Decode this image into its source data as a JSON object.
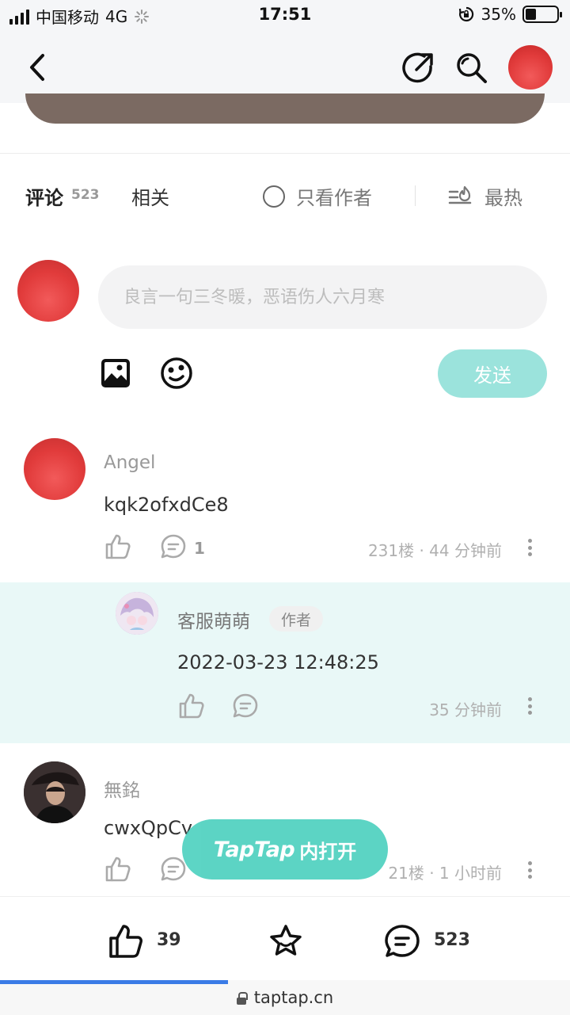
{
  "status_bar": {
    "carrier": "中国移动",
    "network": "4G",
    "time": "17:51",
    "battery": "35%",
    "battery_level": 0.35
  },
  "nav": {
    "icons": [
      "back-icon",
      "share-icon",
      "search-icon",
      "avatar"
    ]
  },
  "tabs": {
    "comments_label": "评论",
    "comments_count": "523",
    "related_label": "相关",
    "author_only_label": "只看作者",
    "sort_label": "最热"
  },
  "compose": {
    "placeholder": "良言一句三冬暖，恶语伤人六月寒",
    "send_label": "发送"
  },
  "comments": [
    {
      "username": "Angel",
      "content": "kqk2ofxdCe8",
      "reply_count": "1",
      "meta": "231楼 · 44 分钟前",
      "reply": {
        "username": "客服萌萌",
        "badge": "作者",
        "content": "2022-03-23 12:48:25",
        "meta": "35 分钟前"
      }
    },
    {
      "username": "無銘",
      "content": "cwxQpCv",
      "meta": "21楼 · 1 小时前"
    }
  ],
  "floating_button": {
    "brand": "TapTap",
    "suffix": "内打开"
  },
  "bottom_bar": {
    "like_count": "39",
    "comment_count": "523"
  },
  "browser": {
    "url": "taptap.cn",
    "load_progress": 0.4
  },
  "colors": {
    "accent_teal": "#4fd1c0",
    "send_disabled": "#9be3dc",
    "reply_background": "#e9f8f7",
    "progress_blue": "#3a7be6"
  }
}
